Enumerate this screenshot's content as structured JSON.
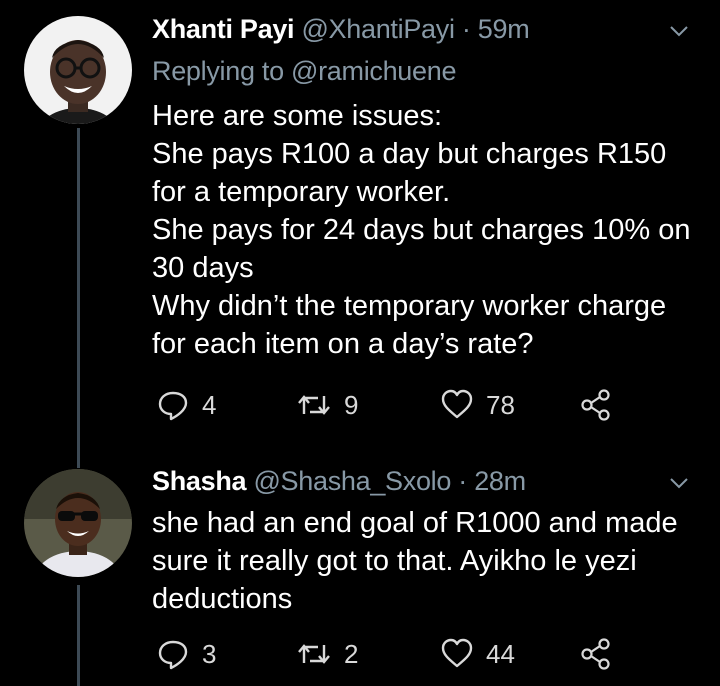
{
  "tweets": [
    {
      "display_name": "Xhanti Payi",
      "handle": "@XhantiPayi",
      "separator": "·",
      "time": "59m",
      "replying_to": "Replying to @ramichuene",
      "lines": [
        "Here are some issues:",
        "She pays R100 a day but charges R150",
        "for a temporary worker.",
        "She pays for 24 days but charges 10% on",
        "30 days",
        "Why didn’t the temporary worker charge",
        "for each item on a day’s rate?"
      ],
      "reply_count": "4",
      "retweet_count": "9",
      "like_count": "78"
    },
    {
      "display_name": "Shasha",
      "handle": "@Shasha_Sxolo",
      "separator": "·",
      "time": "28m",
      "lines": [
        "she had an end goal of R1000 and made",
        "sure it really got to that. Ayikho le yezi",
        "deductions"
      ],
      "reply_count": "3",
      "retweet_count": "2",
      "like_count": "44"
    }
  ],
  "icons": [
    "reply-icon",
    "retweet-icon",
    "like-icon",
    "share-icon",
    "chevron-down-icon"
  ],
  "colors": {
    "background": "#000000",
    "secondary_text": "#8899a6",
    "thread_line": "#3d4a55"
  }
}
